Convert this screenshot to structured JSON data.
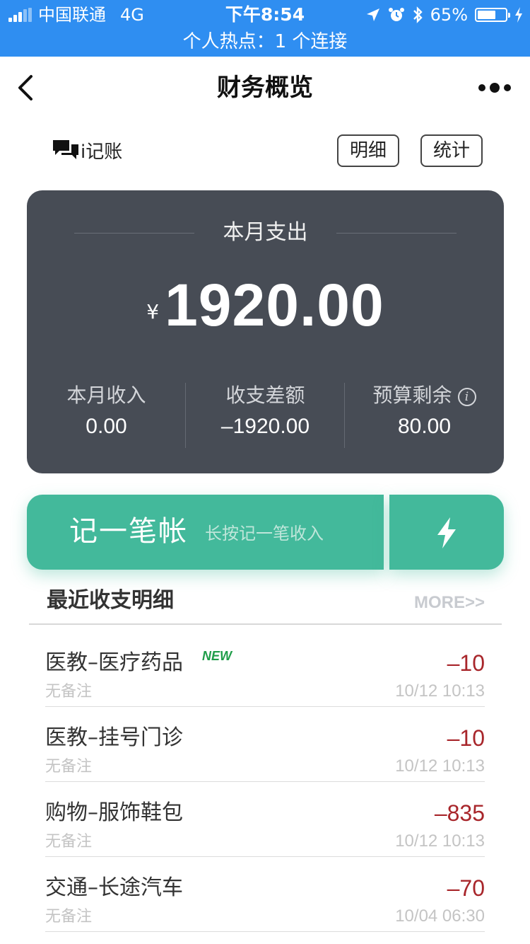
{
  "status_bar": {
    "carrier": "中国联通",
    "network": "4G",
    "time": "下午8:54",
    "battery": "65%",
    "battery_level": 0.65,
    "hotspot": "个人热点：1 个连接"
  },
  "nav": {
    "title": "财务概览"
  },
  "header": {
    "brand": "i记账",
    "detail_button": "明细",
    "stats_button": "统计"
  },
  "summary": {
    "label": "本月支出",
    "currency": "¥",
    "amount": "1920.00",
    "stats": [
      {
        "label": "本月收入",
        "value": "0.00"
      },
      {
        "label": "收支差额",
        "value": "–1920.00"
      },
      {
        "label": "预算剩余",
        "value": "80.00"
      }
    ]
  },
  "actions": {
    "record_label": "记一笔帐",
    "record_hint": "长按记一笔收入"
  },
  "recent": {
    "title": "最近收支明细",
    "more": "MORE>>",
    "items": [
      {
        "title": "医教–医疗药品",
        "note": "无备注",
        "amount": "–10",
        "time": "10/12 10:13",
        "badge": "NEW"
      },
      {
        "title": "医教–挂号门诊",
        "note": "无备注",
        "amount": "–10",
        "time": "10/12 10:13"
      },
      {
        "title": "购物–服饰鞋包",
        "note": "无备注",
        "amount": "–835",
        "time": "10/12 10:13"
      },
      {
        "title": "交通–长途汽车",
        "note": "无备注",
        "amount": "–70",
        "time": "10/04 06:30"
      }
    ]
  },
  "colors": {
    "status_bar": "#2f8ef1",
    "card": "#474c55",
    "accent_green": "#43b99b",
    "expense_red": "#a8262b",
    "new_badge": "#1f9d49"
  }
}
